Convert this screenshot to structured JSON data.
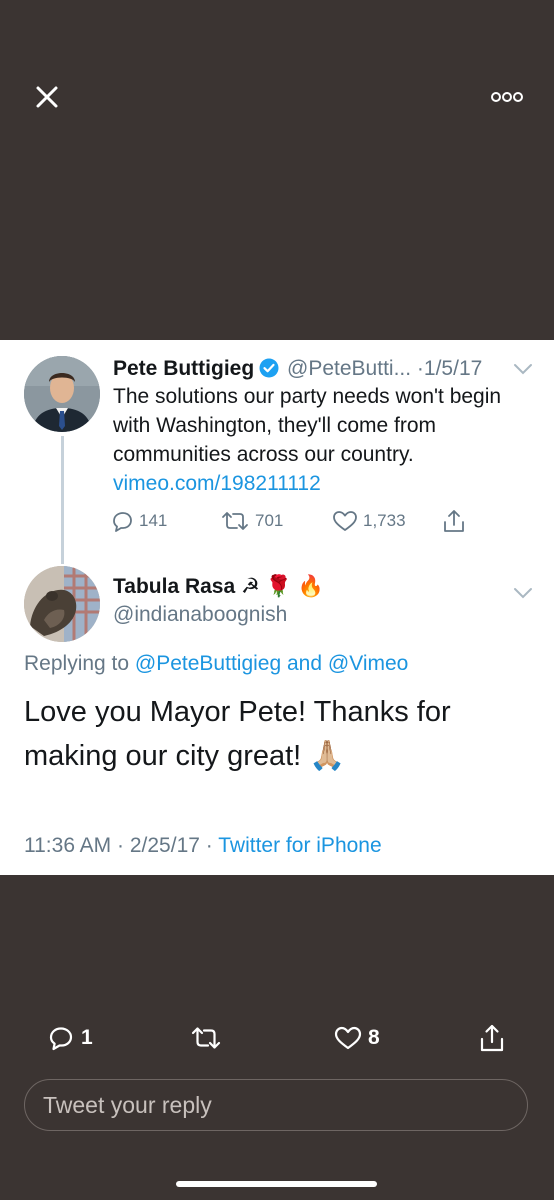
{
  "header": {
    "close_icon": "close-icon",
    "more_icon": "more-options-icon"
  },
  "parent_tweet": {
    "name": "Pete Buttigieg",
    "verified": true,
    "handle": "@PeteButti...",
    "separator": "·",
    "date": "1/5/17",
    "text": "The solutions our party needs won't begin with Washington, they'll come from communities across our country.",
    "link": "vimeo.com/198211112",
    "replies": "141",
    "retweets": "701",
    "likes": "1,733"
  },
  "tweet": {
    "name": "Tabula Rasa",
    "name_emoji": "☭ 🌹 🔥",
    "handle": "@indianaboognish",
    "replying_prefix": "Replying to",
    "mention1": "@PeteButtigieg",
    "and": "and",
    "mention2": "@Vimeo",
    "text": "Love you Mayor Pete! Thanks for making our city great!",
    "emoji": "🙏🏼",
    "time": "11:36 AM",
    "date": "2/25/17",
    "dot": "·",
    "source": "Twitter for iPhone"
  },
  "actions": {
    "replies": "1",
    "likes": "8"
  },
  "reply_box": {
    "placeholder": "Tweet your reply"
  },
  "colors": {
    "background": "#3b3432",
    "link": "#1b95e0",
    "secondary": "#657786",
    "text": "#14171a"
  }
}
